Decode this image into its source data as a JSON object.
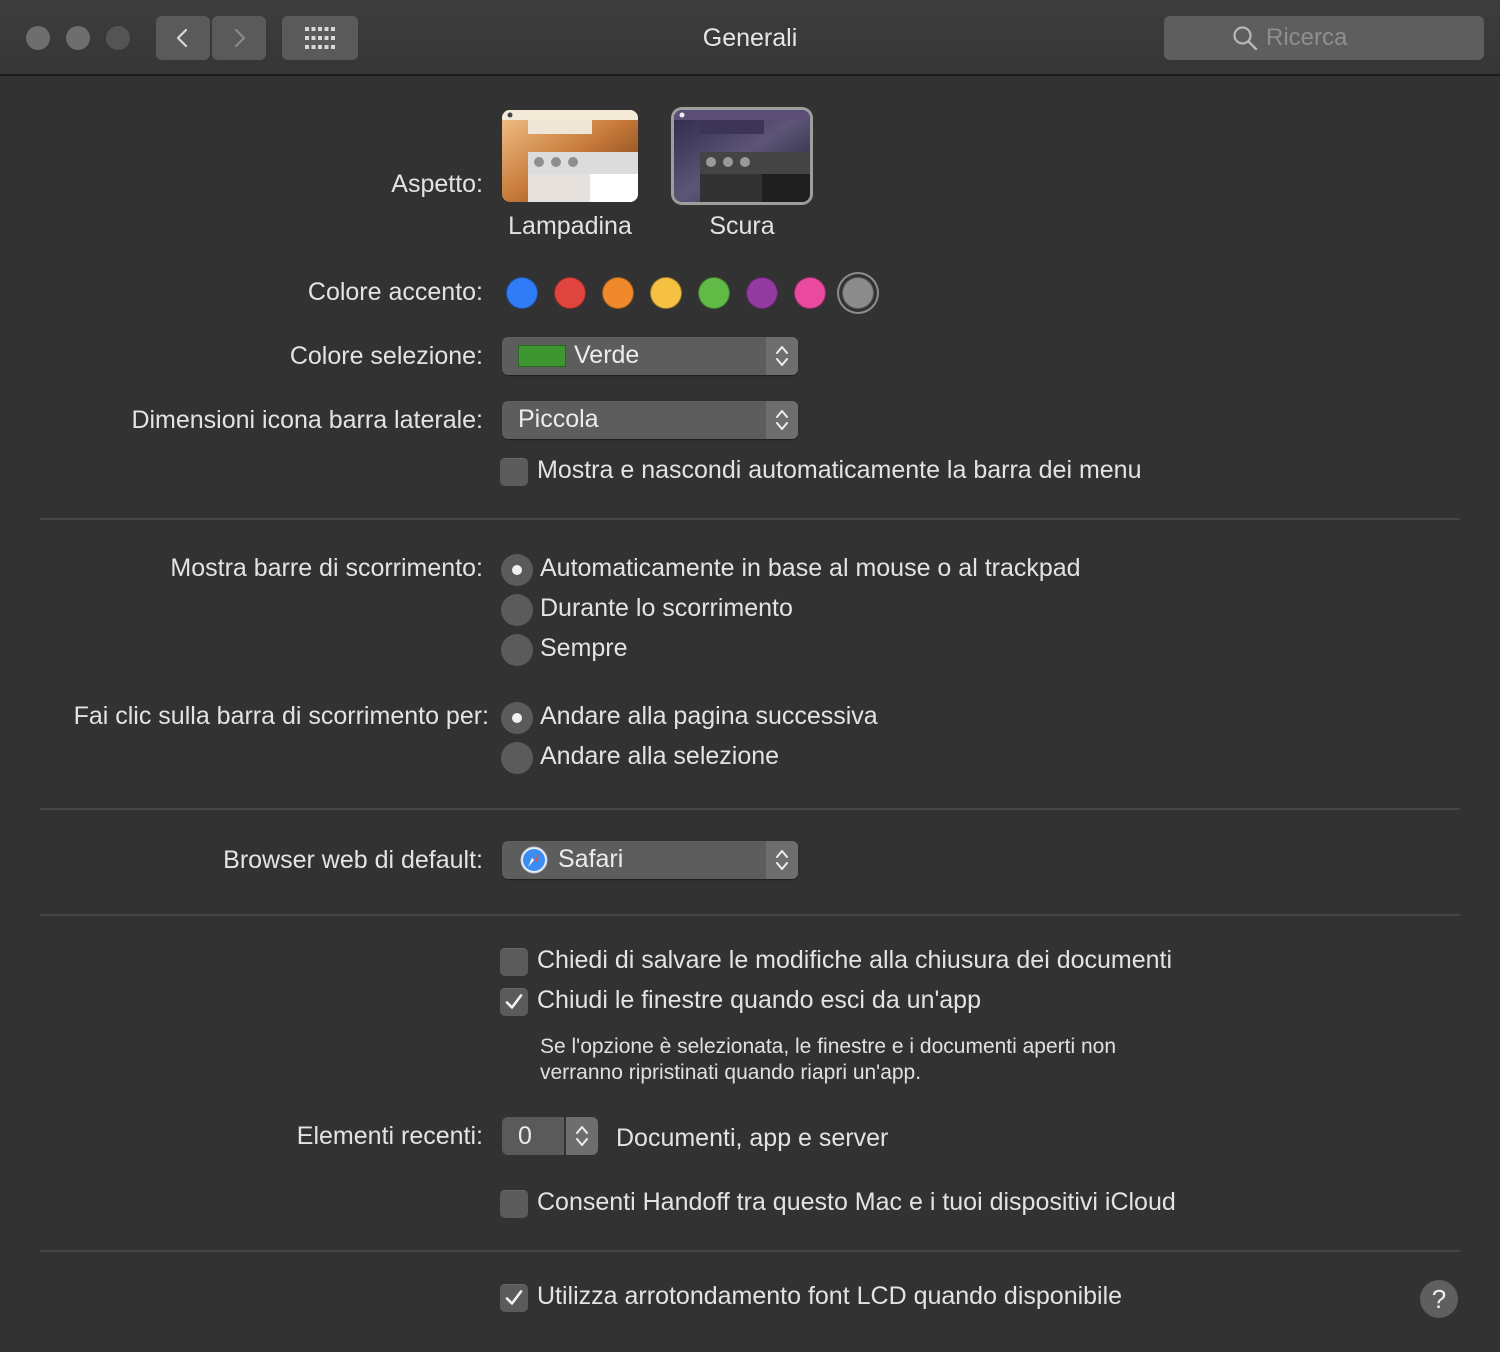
{
  "window": {
    "title": "Generali"
  },
  "search": {
    "placeholder": "Ricerca"
  },
  "appearance": {
    "label": "Aspetto:",
    "options": [
      {
        "name": "Lampadina",
        "selected": false
      },
      {
        "name": "Scura",
        "selected": true
      }
    ]
  },
  "accent": {
    "label": "Colore accento:",
    "colors": [
      "#2f7cf6",
      "#e0443e",
      "#f0892b",
      "#f6c143",
      "#62ba46",
      "#943ba1",
      "#e9499e",
      "#8c8c8c"
    ],
    "selected_index": 7
  },
  "highlight": {
    "label": "Colore selezione:",
    "value": "Verde",
    "swatch_color": "#3d9632"
  },
  "sidebar_icon_size": {
    "label": "Dimensioni icona barra laterale:",
    "value": "Piccola"
  },
  "menubar_autohide": {
    "label": "Mostra e nascondi automaticamente la barra dei menu",
    "checked": false
  },
  "scrollbars": {
    "label": "Mostra barre di scorrimento:",
    "options": [
      {
        "label": "Automaticamente in base al mouse o al trackpad",
        "selected": true
      },
      {
        "label": "Durante lo scorrimento",
        "selected": false
      },
      {
        "label": "Sempre",
        "selected": false
      }
    ]
  },
  "scroll_click": {
    "label": "Fai clic sulla barra di scorrimento per:",
    "options": [
      {
        "label": "Andare alla pagina successiva",
        "selected": true
      },
      {
        "label": "Andare alla selezione",
        "selected": false
      }
    ]
  },
  "default_browser": {
    "label": "Browser web di default:",
    "value": "Safari"
  },
  "ask_save": {
    "label": "Chiedi di salvare le modifiche alla chiusura dei documenti",
    "checked": false
  },
  "close_windows": {
    "label": "Chiudi le finestre quando esci da un'app",
    "checked": true,
    "note_line1": "Se l'opzione è selezionata, le finestre e i documenti aperti non",
    "note_line2": "verranno ripristinati quando riapri un'app."
  },
  "recent_items": {
    "label": "Elementi recenti:",
    "value": "0",
    "suffix": "Documenti, app e server"
  },
  "handoff": {
    "label": "Consenti Handoff tra questo Mac e i tuoi dispositivi iCloud",
    "checked": false
  },
  "lcd_smoothing": {
    "label": "Utilizza arrotondamento font LCD quando disponibile",
    "checked": true
  },
  "help": {
    "label": "?"
  }
}
